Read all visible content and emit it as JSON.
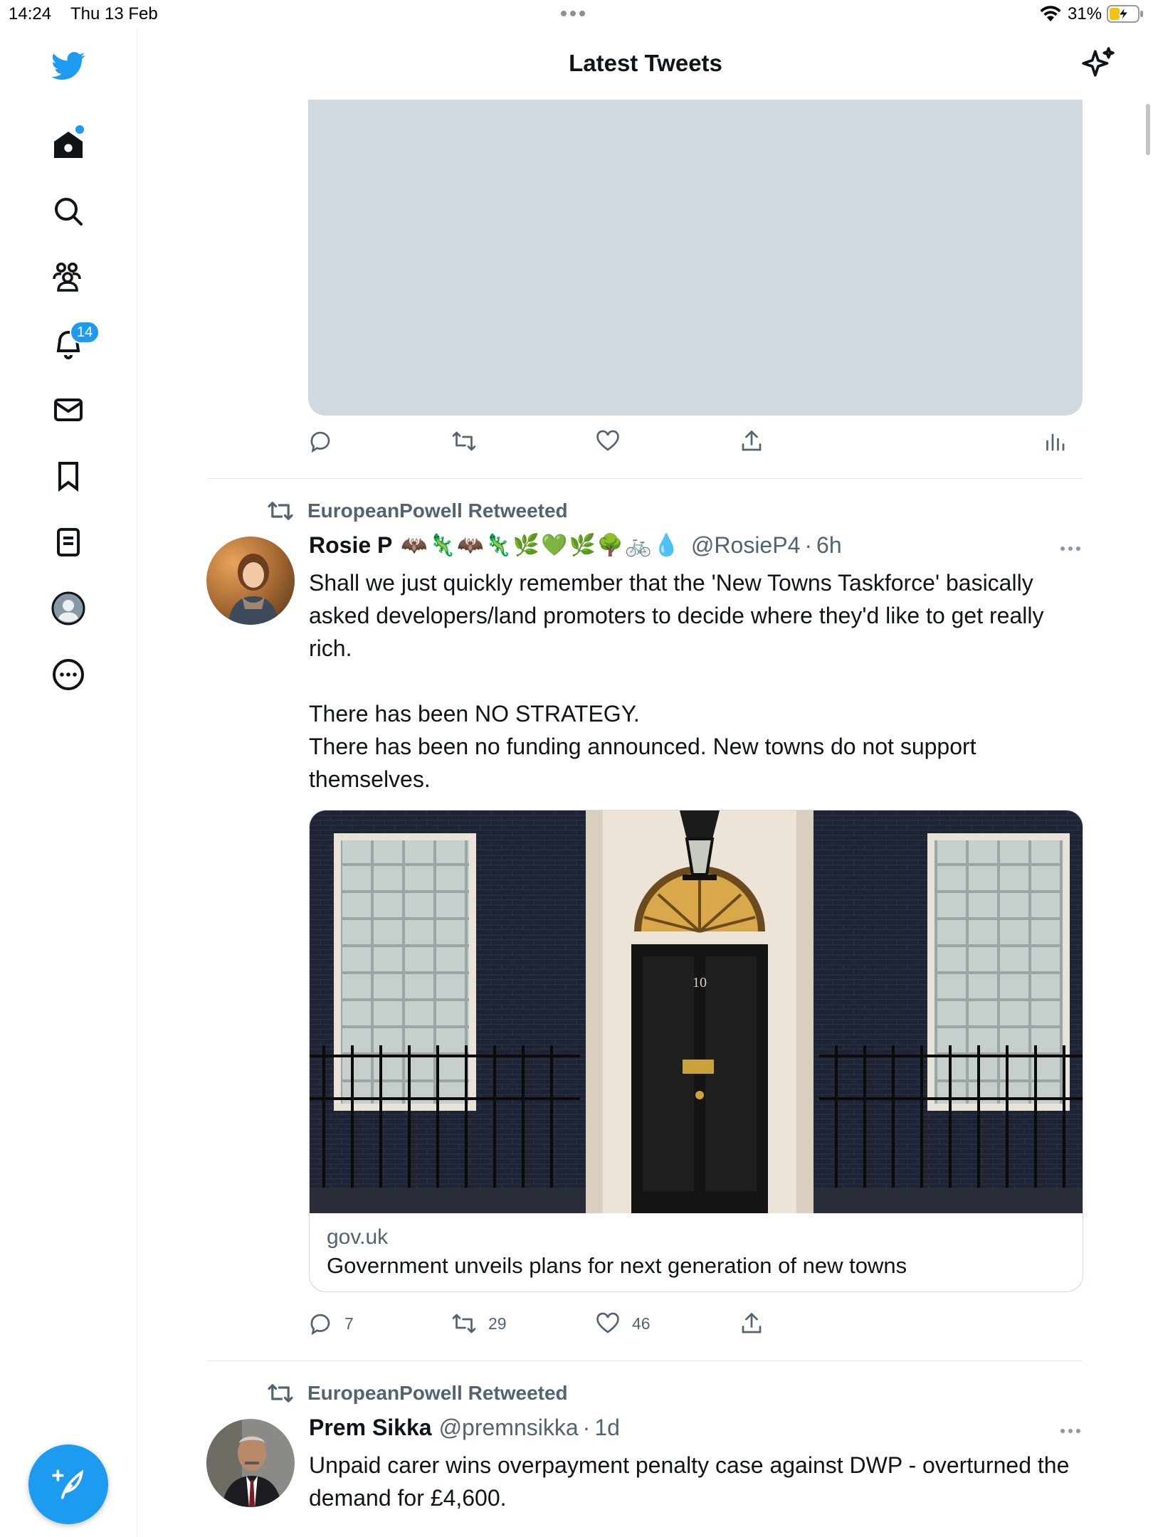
{
  "status_bar": {
    "time": "14:24",
    "date": "Thu 13 Feb",
    "battery": "31%"
  },
  "sidebar": {
    "items": [
      {
        "name": "home",
        "icon": "home-icon"
      },
      {
        "name": "explore",
        "icon": "search-icon"
      },
      {
        "name": "communities",
        "icon": "communities-icon"
      },
      {
        "name": "notifications",
        "icon": "bell-icon",
        "badge": "14"
      },
      {
        "name": "messages",
        "icon": "mail-icon"
      },
      {
        "name": "bookmarks",
        "icon": "bookmark-icon"
      },
      {
        "name": "lists",
        "icon": "list-icon"
      },
      {
        "name": "profile",
        "icon": "avatar-icon"
      },
      {
        "name": "more",
        "icon": "more-circle-icon"
      }
    ],
    "compose_icon": "compose-feather-icon"
  },
  "header": {
    "title": "Latest Tweets",
    "sparkle_icon": "sparkle-icon"
  },
  "colors": {
    "accent": "#1d9bf0",
    "secondary_text": "#536471",
    "media_placeholder": "#cfd9de"
  },
  "tweets": [
    {
      "retweeted_by": "EuropeanPowell Retweeted",
      "name": "Rosie P",
      "emojis": "🦇🦎🦇🦎🌿💚🌿🌳🚲💧",
      "handle": "@RosieP4",
      "time": "6h",
      "text": "Shall we just quickly remember that the 'New Towns Taskforce' basically asked developers/land promoters to decide where they'd like to get really rich.\n\nThere has been NO STRATEGY.\nThere has been no funding announced.  New towns do not support themselves.",
      "card": {
        "door_number": "10",
        "domain": "gov.uk",
        "title": "Government unveils plans for next generation of new towns"
      },
      "replies": "7",
      "retweets": "29",
      "likes": "46"
    },
    {
      "retweeted_by": "EuropeanPowell Retweeted",
      "name": "Prem Sikka",
      "handle": "@premnsikka",
      "time": "1d",
      "text": "Unpaid carer wins overpayment penalty case against DWP - overturned the demand for £4,600."
    }
  ]
}
